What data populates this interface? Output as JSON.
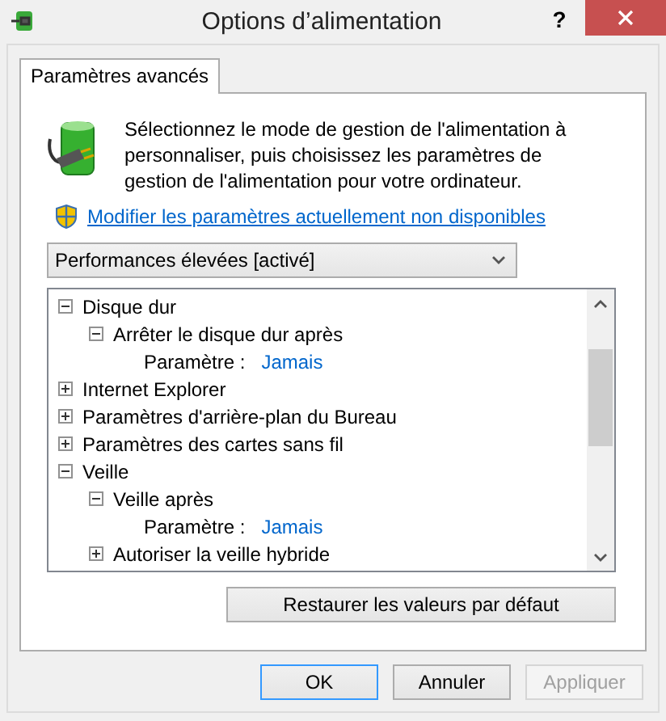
{
  "window": {
    "title": "Options d’alimentation",
    "help": "?"
  },
  "tabs": [
    {
      "label": "Paramètres avancés",
      "selected": true
    }
  ],
  "intro": "Sélectionnez le mode de gestion de l'alimentation à personnaliser, puis choisissez les paramètres de gestion de l'alimentation pour votre ordinateur.",
  "link": "Modifier les paramètres actuellement non disponibles",
  "plan_select": {
    "value": "Performances élevées [activé]"
  },
  "tree": [
    {
      "kind": "group",
      "label": "Disque dur",
      "expanded": true,
      "children": [
        {
          "kind": "group",
          "label": "Arrêter le disque dur après",
          "expanded": true,
          "children": [
            {
              "kind": "setting",
              "label": "Paramètre :",
              "value": "Jamais"
            }
          ]
        }
      ]
    },
    {
      "kind": "group",
      "label": "Internet Explorer",
      "expanded": false
    },
    {
      "kind": "group",
      "label": "Paramètres d'arrière-plan du Bureau",
      "expanded": false
    },
    {
      "kind": "group",
      "label": "Paramètres des cartes sans fil",
      "expanded": false
    },
    {
      "kind": "group",
      "label": "Veille",
      "expanded": true,
      "children": [
        {
          "kind": "group",
          "label": "Veille après",
          "expanded": true,
          "children": [
            {
              "kind": "setting",
              "label": "Paramètre :",
              "value": "Jamais"
            }
          ]
        },
        {
          "kind": "group",
          "label": "Autoriser la veille hybride",
          "expanded": false
        }
      ]
    }
  ],
  "restore_button": "Restaurer les valeurs par défaut",
  "buttons": [
    {
      "label": "OK",
      "default": true,
      "disabled": false
    },
    {
      "label": "Annuler",
      "default": false,
      "disabled": false
    },
    {
      "label": "Appliquer",
      "default": false,
      "disabled": true
    }
  ]
}
